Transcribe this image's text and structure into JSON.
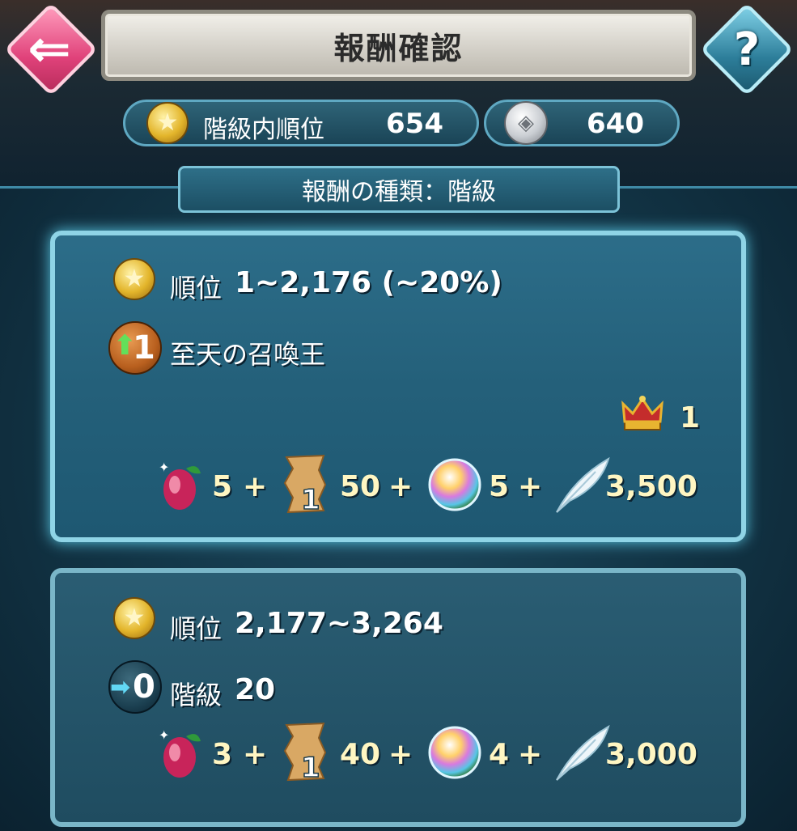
{
  "header": {
    "title": "報酬確認",
    "back_icon": "back-arrow-icon",
    "help_icon": "question-mark-icon",
    "back_glyph": "⇐",
    "help_glyph": "?"
  },
  "stats": {
    "rank_label": "階級内順位",
    "rank_value": "654",
    "score_value": "640"
  },
  "section": {
    "label": "報酬の種類：階級"
  },
  "tiers": [
    {
      "rank_label": "順位",
      "rank_value": "1~2,176 (~20%)",
      "change_badge": "1",
      "change_text": "至天の召喚王",
      "crown_count": "1",
      "rewards": [
        {
          "icon": "grail-fruit-icon",
          "value": "5"
        },
        {
          "icon": "scroll-icon",
          "value": "50",
          "overlay": "1"
        },
        {
          "icon": "orb-icon",
          "value": "5"
        },
        {
          "icon": "feather-icon",
          "value": "3,500"
        }
      ]
    },
    {
      "rank_label": "順位",
      "rank_value": "2,177~3,264",
      "change_badge": "0",
      "change_label": "階級",
      "change_value": "20",
      "rewards": [
        {
          "icon": "grail-fruit-icon",
          "value": "3"
        },
        {
          "icon": "scroll-icon",
          "value": "40",
          "overlay": "1"
        },
        {
          "icon": "orb-icon",
          "value": "4"
        },
        {
          "icon": "feather-icon",
          "value": "3,000"
        }
      ]
    }
  ],
  "plus_sign": "+",
  "colors": {
    "accent": "#8fd4e6",
    "gold_text": "#fff6c2",
    "back_button": "#e0427a",
    "help_button": "#2d7e9a"
  }
}
